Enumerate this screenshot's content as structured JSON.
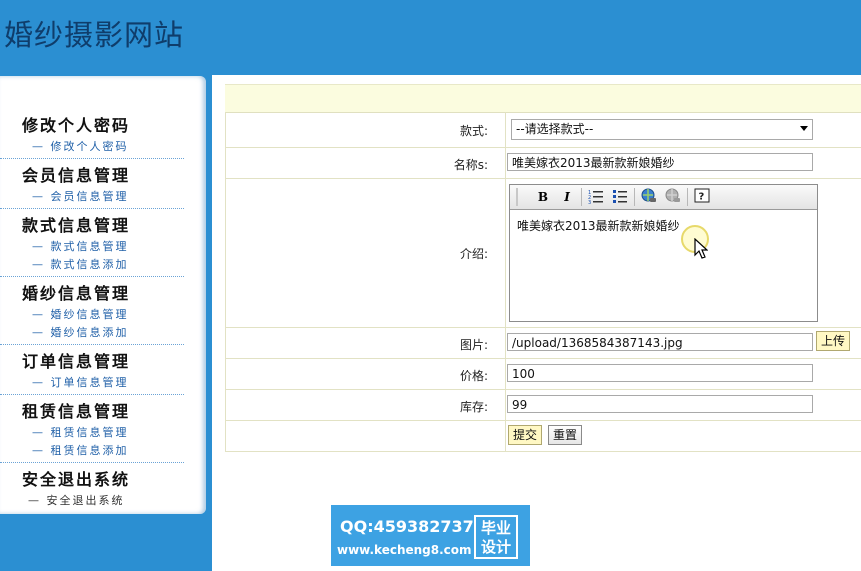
{
  "header": {
    "site_title": "婚纱摄影网站"
  },
  "sidebar": {
    "groups": [
      {
        "title": "修改个人密码",
        "links": [
          "— 修改个人密码"
        ]
      },
      {
        "title": "会员信息管理",
        "links": [
          "— 会员信息管理"
        ]
      },
      {
        "title": "款式信息管理",
        "links": [
          "— 款式信息管理",
          "— 款式信息添加"
        ]
      },
      {
        "title": "婚纱信息管理",
        "links": [
          "— 婚纱信息管理",
          "— 婚纱信息添加"
        ]
      },
      {
        "title": "订单信息管理",
        "links": [
          "— 订单信息管理"
        ]
      },
      {
        "title": "租赁信息管理",
        "links": [
          "— 租赁信息管理",
          "— 租赁信息添加"
        ]
      },
      {
        "title": "安全退出系统",
        "links": [
          "— 安全退出系统"
        ]
      }
    ]
  },
  "form": {
    "style_label": "款式:",
    "style_selected": "--请选择款式--",
    "name_label": "名称s:",
    "name_value": "唯美嫁衣2013最新款新娘婚纱",
    "intro_label": "介绍:",
    "intro_text": "唯美嫁衣2013最新款新娘婚纱",
    "image_label": "图片:",
    "image_value": "/upload/1368584387143.jpg",
    "upload_button": "上传",
    "price_label": "价格:",
    "price_value": "100",
    "stock_label": "库存:",
    "stock_value": "99",
    "submit_button": "提交",
    "reset_button": "重置"
  },
  "editor_toolbar": {
    "bold": "B",
    "italic": "I",
    "icons": [
      "bold-icon",
      "italic-icon",
      "ordered-list-icon",
      "unordered-list-icon",
      "link-icon",
      "unlink-icon",
      "help-icon"
    ]
  },
  "watermark": {
    "qq": "QQ:459382737",
    "url": "www.kecheng8.com",
    "badge_line1": "毕业",
    "badge_line2": "设计"
  }
}
